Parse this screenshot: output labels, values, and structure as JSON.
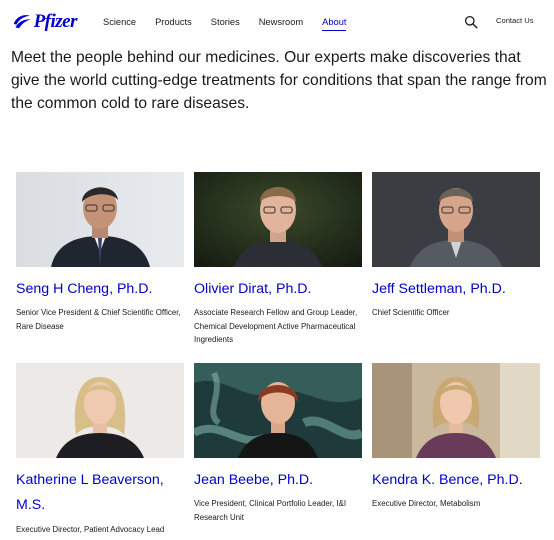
{
  "brand": {
    "name": "Pfizer",
    "color": "#0000c9"
  },
  "nav": {
    "items": [
      {
        "label": "Science"
      },
      {
        "label": "Products"
      },
      {
        "label": "Stories"
      },
      {
        "label": "Newsroom"
      },
      {
        "label": "About",
        "active": true
      }
    ],
    "search_icon": "search-icon",
    "contact_label": "Contact Us"
  },
  "intro": "Meet the people behind our medicines. Our experts make discoveries that give the world cutting-edge treatments for conditions that span the range from the common cold to rare diseases.",
  "people": [
    {
      "name": "Seng H Cheng, Ph.D.",
      "role": "Senior Vice President & Chief Scientific Officer, Rare Disease",
      "photo": "portrait-man-glasses-suit"
    },
    {
      "name": "Olivier Dirat, Ph.D.",
      "role": "Associate Research Fellow and Group Leader, Chemical Development Active Pharmaceutical Ingredients",
      "photo": "portrait-man-glasses-dark-background"
    },
    {
      "name": "Jeff Settleman, Ph.D.",
      "role": "Chief Scientific Officer",
      "photo": "portrait-man-glasses-grey-background"
    },
    {
      "name": "Katherine L Beaverson, M.S.",
      "role": "Executive Director, Patient Advocacy Lead",
      "photo": "portrait-woman-blonde-light-background"
    },
    {
      "name": "Jean Beebe, Ph.D.",
      "role": "Vice President, Clinical Portfolio Leader, I&I Research Unit",
      "photo": "portrait-woman-microscopy-background"
    },
    {
      "name": "Kendra K. Bence, Ph.D.",
      "role": "Executive Director, Metabolism",
      "photo": "portrait-woman-blonde-office-background"
    }
  ]
}
